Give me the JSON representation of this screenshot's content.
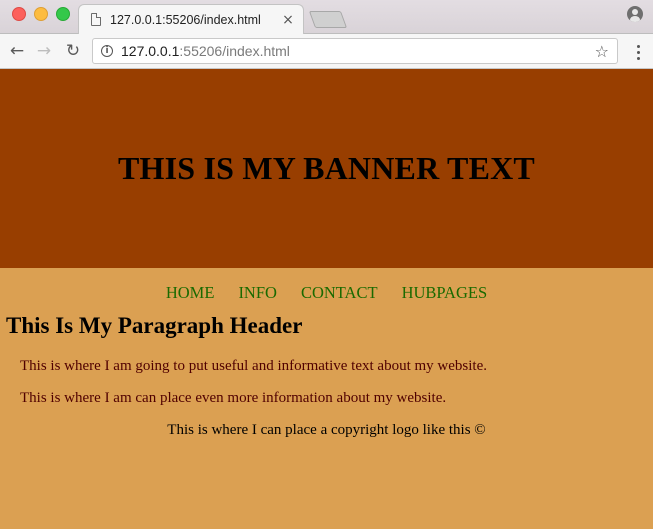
{
  "browser": {
    "tab_title": "127.0.0.1:55206/index.html",
    "tab_close": "×",
    "url_host": "127.0.0.1",
    "url_rest": ":55206/index.html",
    "info_glyph": "i",
    "star_glyph": "☆",
    "back_glyph": "←",
    "forward_glyph": "→",
    "reload_glyph": "↻"
  },
  "banner": {
    "text": "THIS IS MY BANNER TEXT"
  },
  "nav": {
    "items": [
      {
        "label": "HOME"
      },
      {
        "label": "INFO"
      },
      {
        "label": "CONTACT"
      },
      {
        "label": "HUBPAGES"
      }
    ]
  },
  "content": {
    "header": "This Is My Paragraph Header",
    "paragraph_1": "This is where I am going to put useful and informative text about my website.",
    "paragraph_2": "This is where I am can place even more information about my website.",
    "copyright": "This is where I can place a copyright logo like this ©"
  },
  "colors": {
    "banner_bg": "#983e00",
    "page_bg": "#dba052",
    "nav_link": "#1a6a00",
    "paragraph_text": "#500000"
  }
}
